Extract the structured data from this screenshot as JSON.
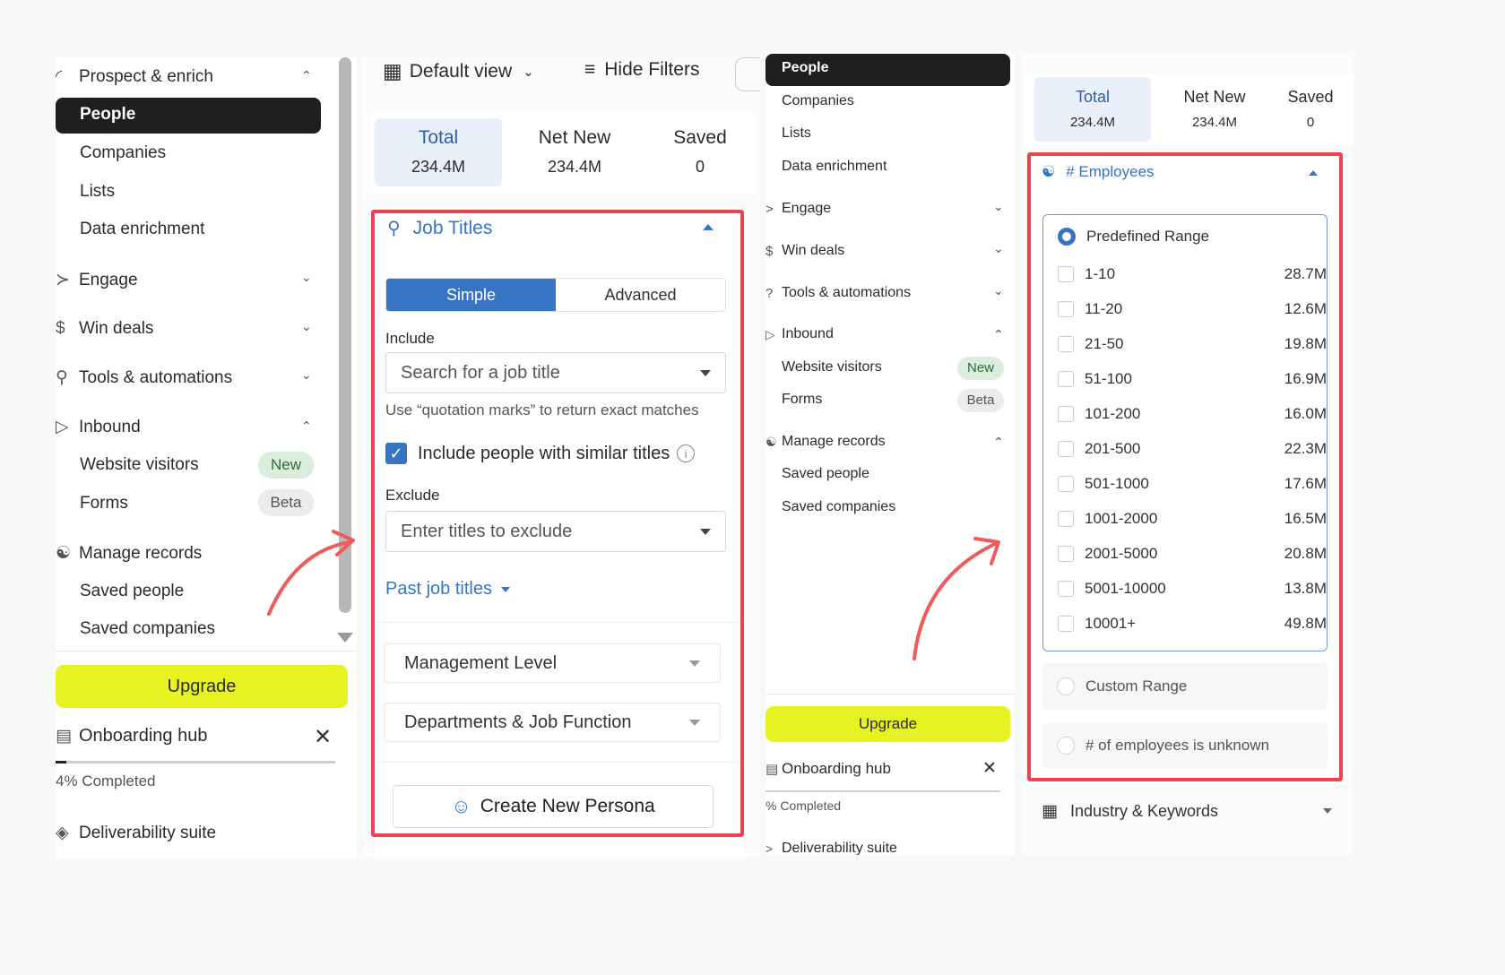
{
  "panel1": {
    "sidebar": {
      "prospect_label": "Prospect & enrich",
      "people": "People",
      "companies": "Companies",
      "lists": "Lists",
      "data_enrichment": "Data enrichment",
      "engage": "Engage",
      "win_deals": "Win deals",
      "tools": "Tools & automations",
      "inbound": "Inbound",
      "website_visitors": "Website visitors",
      "badge_new": "New",
      "forms": "Forms",
      "badge_beta": "Beta",
      "manage_records": "Manage records",
      "saved_people": "Saved people",
      "saved_companies": "Saved companies",
      "upgrade": "Upgrade",
      "onboarding": "Onboarding hub",
      "completed": "4% Completed",
      "deliverability": "Deliverability suite"
    },
    "toolbar": {
      "view": "Default view",
      "hide_filters": "Hide Filters"
    },
    "stats": {
      "total_label": "Total",
      "total_value": "234.4M",
      "netnew_label": "Net New",
      "netnew_value": "234.4M",
      "saved_label": "Saved",
      "saved_value": "0"
    },
    "job_titles": {
      "title": "Job Titles",
      "tab_simple": "Simple",
      "tab_advanced": "Advanced",
      "include_label": "Include",
      "include_placeholder": "Search for a job title",
      "hint": "Use “quotation marks” to return exact matches",
      "similar_label": "Include people with similar titles",
      "exclude_label": "Exclude",
      "exclude_placeholder": "Enter titles to exclude",
      "past_titles": "Past job titles",
      "management_level": "Management Level",
      "departments": "Departments & Job Function",
      "create_persona": "Create New Persona"
    }
  },
  "panel2": {
    "sidebar": {
      "people": "People",
      "companies": "Companies",
      "lists": "Lists",
      "data_enrichment": "Data enrichment",
      "engage": "Engage",
      "win_deals": "Win deals",
      "tools": "Tools & automations",
      "inbound": "Inbound",
      "website_visitors": "Website visitors",
      "badge_new": "New",
      "forms": "Forms",
      "badge_beta": "Beta",
      "manage_records": "Manage records",
      "saved_people": "Saved people",
      "saved_companies": "Saved companies",
      "upgrade": "Upgrade",
      "onboarding": "Onboarding hub",
      "completed": "% Completed",
      "deliverability": "Deliverability suite"
    },
    "stats": {
      "total_label": "Total",
      "total_value": "234.4M",
      "netnew_label": "Net New",
      "netnew_value": "234.4M",
      "saved_label": "Saved",
      "saved_value": "0"
    },
    "employees": {
      "title": "# Employees",
      "predefined": "Predefined Range",
      "ranges": [
        {
          "label": "1-10",
          "count": "28.7M"
        },
        {
          "label": "11-20",
          "count": "12.6M"
        },
        {
          "label": "21-50",
          "count": "19.8M"
        },
        {
          "label": "51-100",
          "count": "16.9M"
        },
        {
          "label": "101-200",
          "count": "16.0M"
        },
        {
          "label": "201-500",
          "count": "22.3M"
        },
        {
          "label": "501-1000",
          "count": "17.6M"
        },
        {
          "label": "1001-2000",
          "count": "16.5M"
        },
        {
          "label": "2001-5000",
          "count": "20.8M"
        },
        {
          "label": "5001-10000",
          "count": "13.8M"
        },
        {
          "label": "10001+",
          "count": "49.8M"
        }
      ],
      "custom": "Custom Range",
      "unknown": "# of employees is unknown"
    },
    "industry": "Industry & Keywords"
  },
  "colors": {
    "accent": "#3874c4",
    "highlight": "#e8454f",
    "upgrade": "#e6f221"
  }
}
